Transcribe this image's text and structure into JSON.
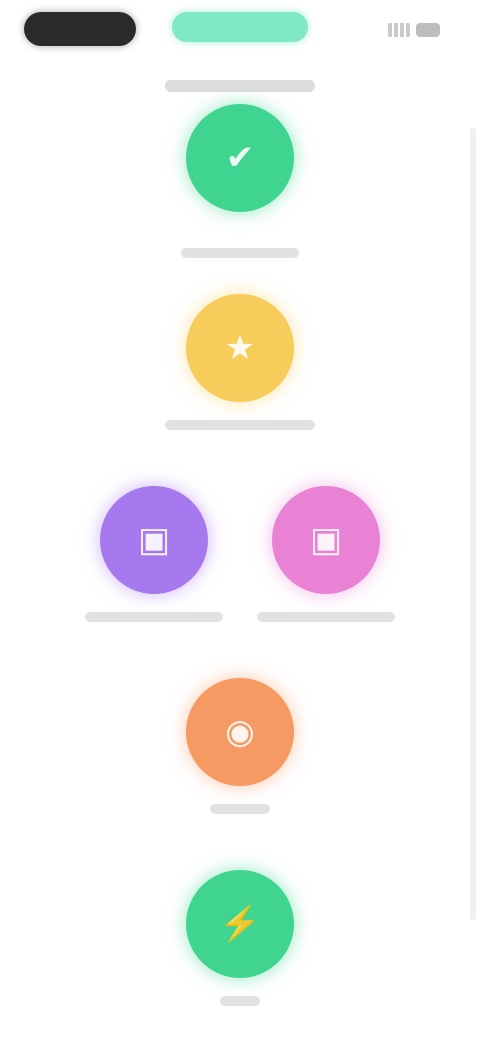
{
  "header": {
    "left_pill_color": "#2b2b2b",
    "center_pill_color": "#7fe8c7"
  },
  "path": {
    "nodes": [
      {
        "name": "node-1",
        "color": "#3fd490",
        "icon": "checkmark-icon",
        "glyph": "✔",
        "label": ""
      },
      {
        "name": "node-2",
        "color": "#f6cc5a",
        "icon": "star-icon",
        "glyph": "★",
        "label": ""
      },
      {
        "name": "node-3",
        "color": "#a779ee",
        "icon": "book-icon",
        "glyph": "▣",
        "label": ""
      },
      {
        "name": "node-4",
        "color": "#e981d4",
        "icon": "book-icon",
        "glyph": "▣",
        "label": ""
      },
      {
        "name": "node-5",
        "color": "#f59a63",
        "icon": "dumbbell-icon",
        "glyph": "◉",
        "label": ""
      },
      {
        "name": "node-6",
        "color": "#3fd490",
        "icon": "lightning-icon",
        "glyph": "⚡",
        "label": ""
      }
    ]
  }
}
